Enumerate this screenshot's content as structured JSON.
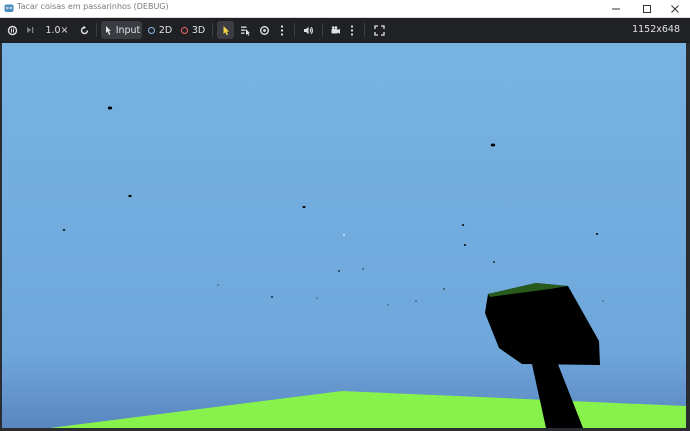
{
  "window": {
    "title": "Tacar coisas em passarinhos (DEBUG)",
    "icon": "godot-icon",
    "controls": [
      "minimize-icon",
      "maximize-icon",
      "close-icon"
    ]
  },
  "toolbar": {
    "speed_label": "1.0×",
    "input_label": "Input",
    "mode_2d_label": "2D",
    "mode_3d_label": "3D",
    "resolution": "1152x648",
    "colors": {
      "background": "#202125",
      "text": "#e2e3e6",
      "accent_2d": "#8fb9e6",
      "accent_3d": "#f06a6a",
      "select_arrow": "#f2d24a"
    },
    "icons": [
      "suspend-icon",
      "next-frame-icon",
      "reset-speed-icon",
      "input-icon",
      "select-icon",
      "list-select-icon",
      "camera-eye-icon",
      "more-icon",
      "audio-icon",
      "camera-override-icon",
      "more-icon",
      "fullscreen-icon"
    ]
  },
  "scene": {
    "sky_color": "#78b3e2",
    "ground_color": "#86f24b",
    "tree_trunk_color": "#000000",
    "tree_top_color": "#275a1b",
    "objects": [
      "bird",
      "tree",
      "ground"
    ]
  }
}
